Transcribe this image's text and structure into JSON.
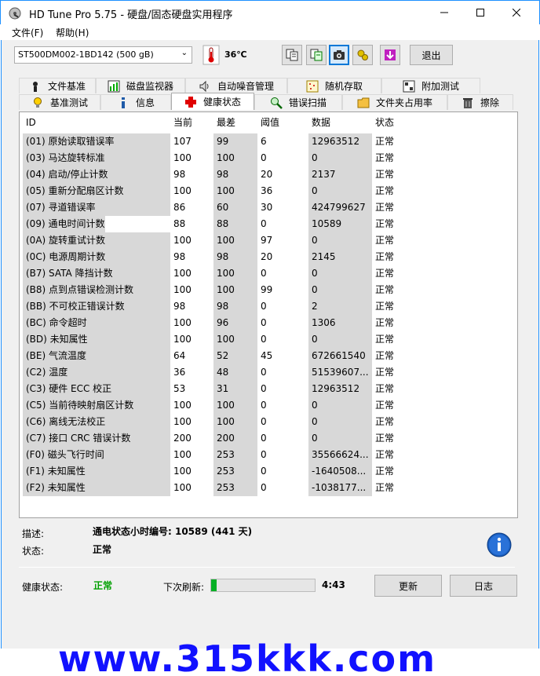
{
  "window": {
    "title": "HD Tune Pro 5.75 - 硬盘/固态硬盘实用程序"
  },
  "menu": {
    "file": "文件(F)",
    "help": "帮助(H)"
  },
  "toolbar": {
    "drive": "ST500DM002-1BD142 (500 gB)",
    "temperature": "36℃",
    "exit_label": "退出"
  },
  "tabs_top": [
    "文件基准",
    "磁盘监视器",
    "自动噪音管理",
    "随机存取",
    "附加测试"
  ],
  "tabs_bottom": [
    "基准测试",
    "信息",
    "健康状态",
    "错误扫描",
    "文件夹占用率",
    "擦除"
  ],
  "selected_tab": "健康状态",
  "table": {
    "headers": [
      "ID",
      "当前",
      "最差",
      "阈值",
      "数据",
      "状态"
    ],
    "rows": [
      [
        "(01) 原始读取错误率",
        "107",
        "99",
        "6",
        "12963512",
        "正常"
      ],
      [
        "(03) 马达旋转标准",
        "100",
        "100",
        "0",
        "0",
        "正常"
      ],
      [
        "(04) 启动/停止计数",
        "98",
        "98",
        "20",
        "2137",
        "正常"
      ],
      [
        "(05) 重新分配扇区计数",
        "100",
        "100",
        "36",
        "0",
        "正常"
      ],
      [
        "(07) 寻道错误率",
        "86",
        "60",
        "30",
        "424799627",
        "正常"
      ],
      [
        "(09) 通电时间计数",
        "88",
        "88",
        "0",
        "10589",
        "正常"
      ],
      [
        "(0A) 旋转重试计数",
        "100",
        "100",
        "97",
        "0",
        "正常"
      ],
      [
        "(0C) 电源周期计数",
        "98",
        "98",
        "20",
        "2145",
        "正常"
      ],
      [
        "(B7) SATA 降挡计数",
        "100",
        "100",
        "0",
        "0",
        "正常"
      ],
      [
        "(B8) 点到点错误检测计数",
        "100",
        "100",
        "99",
        "0",
        "正常"
      ],
      [
        "(BB) 不可校正错误计数",
        "98",
        "98",
        "0",
        "2",
        "正常"
      ],
      [
        "(BC) 命令超时",
        "100",
        "96",
        "0",
        "1306",
        "正常"
      ],
      [
        "(BD) 未知属性",
        "100",
        "100",
        "0",
        "0",
        "正常"
      ],
      [
        "(BE) 气流温度",
        "64",
        "52",
        "45",
        "672661540",
        "正常"
      ],
      [
        "(C2) 温度",
        "36",
        "48",
        "0",
        "51539607...",
        "正常"
      ],
      [
        "(C3) 硬件 ECC 校正",
        "53",
        "31",
        "0",
        "12963512",
        "正常"
      ],
      [
        "(C5) 当前待映射扇区计数",
        "100",
        "100",
        "0",
        "0",
        "正常"
      ],
      [
        "(C6) 离线无法校正",
        "100",
        "100",
        "0",
        "0",
        "正常"
      ],
      [
        "(C7) 接口 CRC 错误计数",
        "200",
        "200",
        "0",
        "0",
        "正常"
      ],
      [
        "(F0) 磁头飞行时间",
        "100",
        "253",
        "0",
        "35566624...",
        "正常"
      ],
      [
        "(F1) 未知属性",
        "100",
        "253",
        "0",
        "-1640508...",
        "正常"
      ],
      [
        "(F2) 未知属性",
        "100",
        "253",
        "0",
        "-1038177...",
        "正常"
      ]
    ],
    "selected_row": 5
  },
  "detail": {
    "desc_label": "描述:",
    "desc_value": "通电状态小时编号: 10589 (441 天)",
    "status_label": "状态:",
    "status_value": "正常"
  },
  "footer": {
    "health_label": "健康状态:",
    "health_value": "正常",
    "refresh_label": "下次刷新:",
    "refresh_time": "4:43",
    "refresh_progress": 0.05,
    "refresh_button": "更新",
    "log_button": "日志"
  },
  "watermark": "www.315kkk.com",
  "colors": {
    "health_ok": "#00a000",
    "progress": "#06b025",
    "watermark": "#1111ff"
  }
}
